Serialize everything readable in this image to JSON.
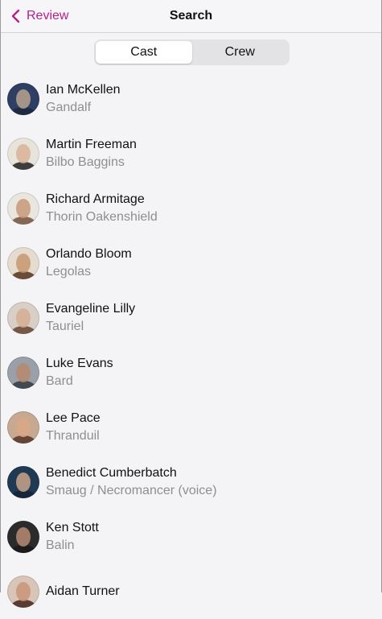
{
  "nav": {
    "back_label": "Review",
    "title": "Search"
  },
  "segments": [
    {
      "label": "Cast",
      "selected": true
    },
    {
      "label": "Crew",
      "selected": false
    }
  ],
  "colors": {
    "accent": "#b3208f",
    "secondary_text": "#8e8e93"
  },
  "cast": [
    {
      "name": "Ian McKellen",
      "role": "Gandalf",
      "bg": "#2e3f63",
      "skin": "#b7a28e",
      "cloth": "#1d2740"
    },
    {
      "name": "Martin Freeman",
      "role": "Bilbo Baggins",
      "bg": "#e8e4dc",
      "skin": "#d9b196",
      "cloth": "#2a2a2a"
    },
    {
      "name": "Richard Armitage",
      "role": "Thorin Oakenshield",
      "bg": "#e9e6e0",
      "skin": "#c79878",
      "cloth": "#7a5a44"
    },
    {
      "name": "Orlando Bloom",
      "role": "Legolas",
      "bg": "#e5dccf",
      "skin": "#c79670",
      "cloth": "#5a3c28"
    },
    {
      "name": "Evangeline Lilly",
      "role": "Tauriel",
      "bg": "#d8cfc6",
      "skin": "#d6ad93",
      "cloth": "#6b4a38"
    },
    {
      "name": "Luke Evans",
      "role": "Bard",
      "bg": "#9aa0a8",
      "skin": "#b58a70",
      "cloth": "#3a3f47"
    },
    {
      "name": "Lee Pace",
      "role": "Thranduil",
      "bg": "#c7a890",
      "skin": "#d8a886",
      "cloth": "#5a3a2c"
    },
    {
      "name": "Benedict Cumberbatch",
      "role": "Smaug / Necromancer (voice)",
      "bg": "#1f3a52",
      "skin": "#c9a48a",
      "cloth": "#152636"
    },
    {
      "name": "Ken Stott",
      "role": "Balin",
      "bg": "#2b2b2b",
      "skin": "#b88a74",
      "cloth": "#1a1a1a"
    },
    {
      "name": "Aidan Turner",
      "role": "",
      "bg": "#d9c4b8",
      "skin": "#c99578",
      "cloth": "#4a2f24"
    }
  ]
}
